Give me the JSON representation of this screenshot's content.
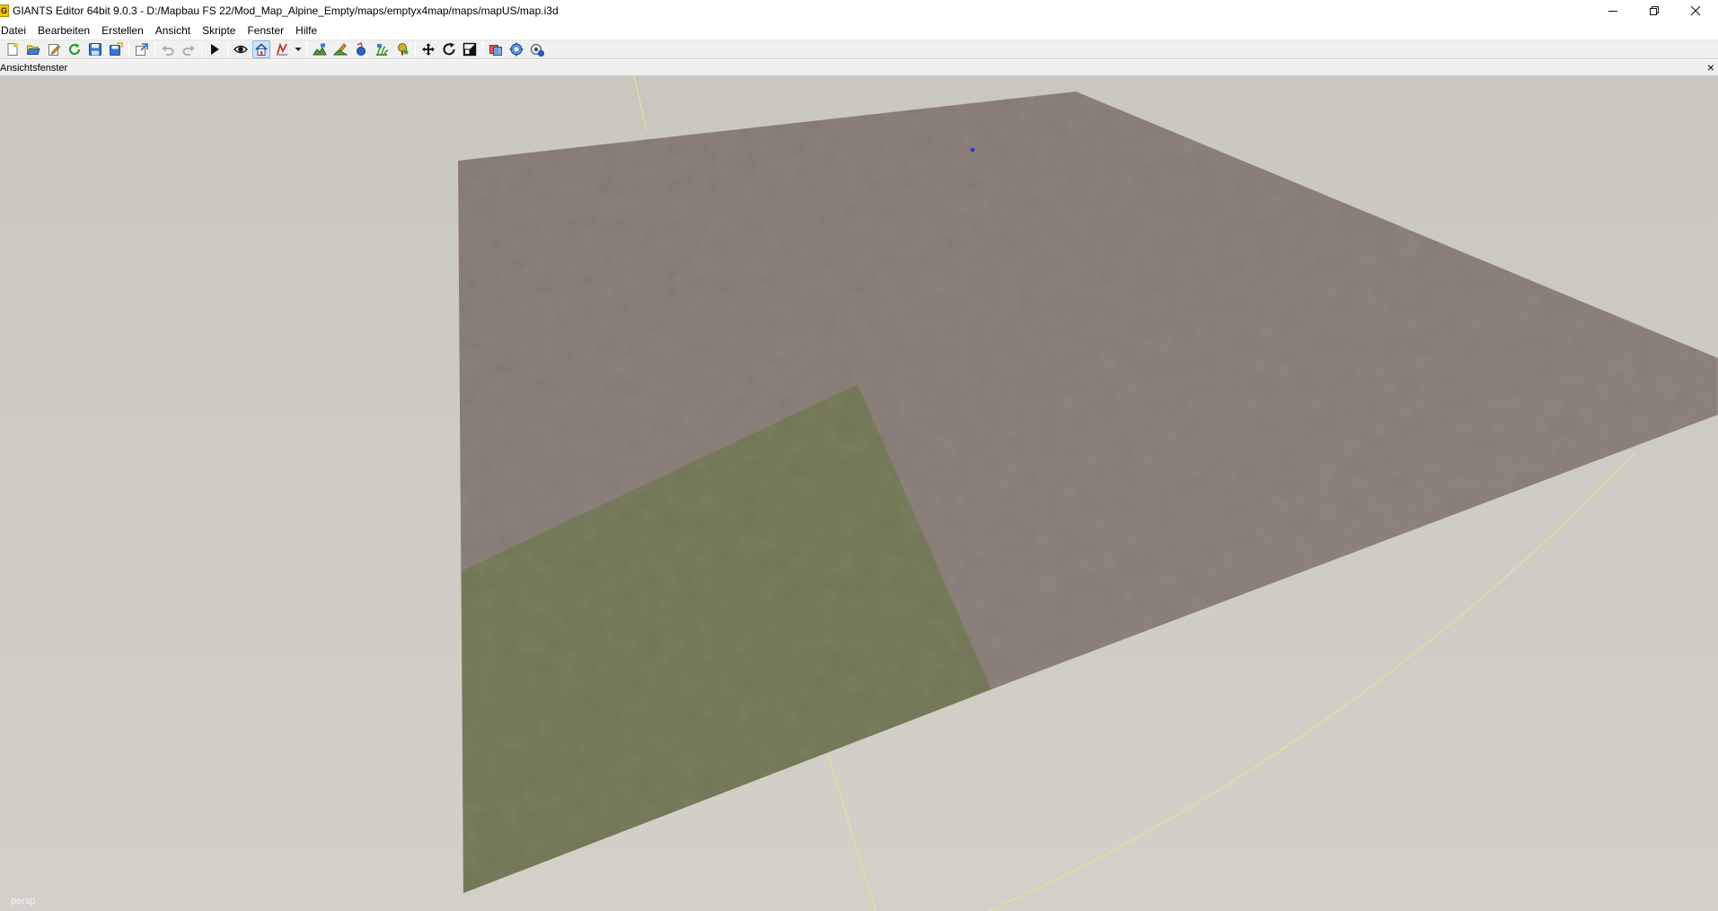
{
  "window": {
    "title": "GIANTS Editor 64bit 9.0.3 - D:/Mapbau FS 22/Mod_Map_Alpine_Empty/maps/emptyx4map/maps/mapUS/map.i3d",
    "app_icon_letter": "G"
  },
  "menu": {
    "items": [
      "Datei",
      "Bearbeiten",
      "Erstellen",
      "Ansicht",
      "Skripte",
      "Fenster",
      "Hilfe"
    ]
  },
  "toolbar": {
    "icons": [
      "new-file-icon",
      "open-folder-icon",
      "edit-file-icon",
      "reload-icon",
      "save-icon",
      "save-as-icon",
      "import-icon",
      "undo-icon",
      "redo-icon",
      "play-icon",
      "eye-icon",
      "home-view-icon",
      "snap-icon",
      "terrain-sculpt-icon",
      "terrain-paint-icon",
      "object-paint-icon",
      "foliage-paint-icon",
      "tree-paint-icon",
      "move-icon",
      "rotate-icon",
      "scale-icon",
      "transform-group-icon",
      "object-settings-icon",
      "physics-settings-icon"
    ],
    "active": [
      "home-view-icon"
    ]
  },
  "panel": {
    "title": "Ansichtsfenster",
    "close_label": "×"
  },
  "viewport": {
    "camera_label": "persp",
    "colors": {
      "background": "#cdcbc2",
      "terrain_brown": "#8e817c",
      "terrain_green": "#7a7f5e",
      "grid_line": "#e2e596",
      "selection_marker": "#1e3fd0"
    }
  }
}
